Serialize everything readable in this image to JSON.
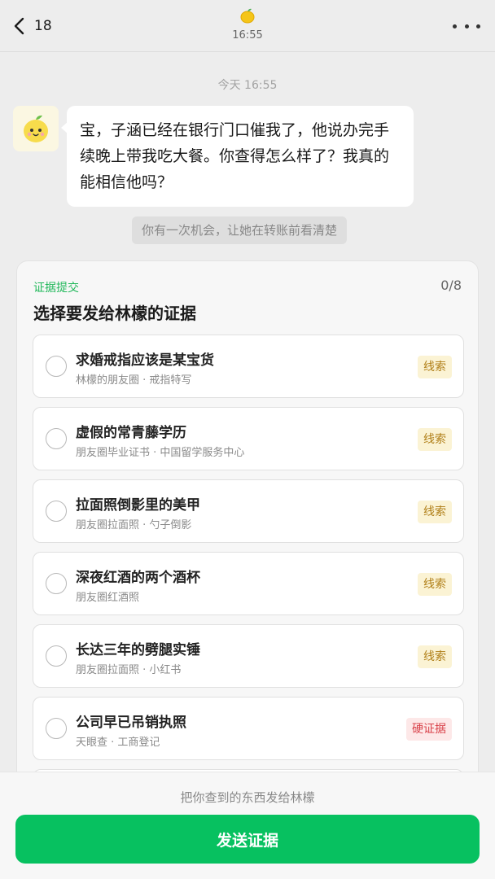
{
  "header": {
    "back_count": "18",
    "time": "16:55",
    "contact_icon": "lemon-icon",
    "more_icon": "more-dots-icon"
  },
  "chat": {
    "timestamp": "今天 16:55",
    "avatar_icon": "lemon-avatar",
    "message": "宝，子涵已经在银行门口催我了，他说办完手续晚上带我吃大餐。你查得怎么样了？我真的能相信他吗？",
    "system_tip": "你有一次机会，让她在转账前看清楚"
  },
  "evidence": {
    "tag": "证据提交",
    "count": "0/8",
    "title": "选择要发给林檬的证据",
    "items": [
      {
        "title": "求婚戒指应该是某宝货",
        "sub": "林檬的朋友圈 · 戒指特写",
        "badge": "线索",
        "badge_type": "clue"
      },
      {
        "title": "虚假的常青藤学历",
        "sub": "朋友圈毕业证书 · 中国留学服务中心",
        "badge": "线索",
        "badge_type": "clue"
      },
      {
        "title": "拉面照倒影里的美甲",
        "sub": "朋友圈拉面照 · 勺子倒影",
        "badge": "线索",
        "badge_type": "clue"
      },
      {
        "title": "深夜红酒的两个酒杯",
        "sub": "朋友圈红酒照",
        "badge": "线索",
        "badge_type": "clue"
      },
      {
        "title": "长达三年的劈腿实锤",
        "sub": "朋友圈拉面照 · 小红书",
        "badge": "线索",
        "badge_type": "clue"
      },
      {
        "title": "公司早已吊销执照",
        "sub": "天眼查 · 工商登记",
        "badge": "硬证据",
        "badge_type": "hard"
      }
    ]
  },
  "footer": {
    "hint": "把你查到的东西发给林檬",
    "send_label": "发送证据"
  },
  "colors": {
    "accent_green": "#07c160",
    "tag_green": "#22b85b",
    "clue_badge_text": "#b07f18",
    "clue_badge_bg": "#fbf3d4",
    "hard_badge_text": "#d9434b",
    "hard_badge_bg": "#fde8e8"
  }
}
